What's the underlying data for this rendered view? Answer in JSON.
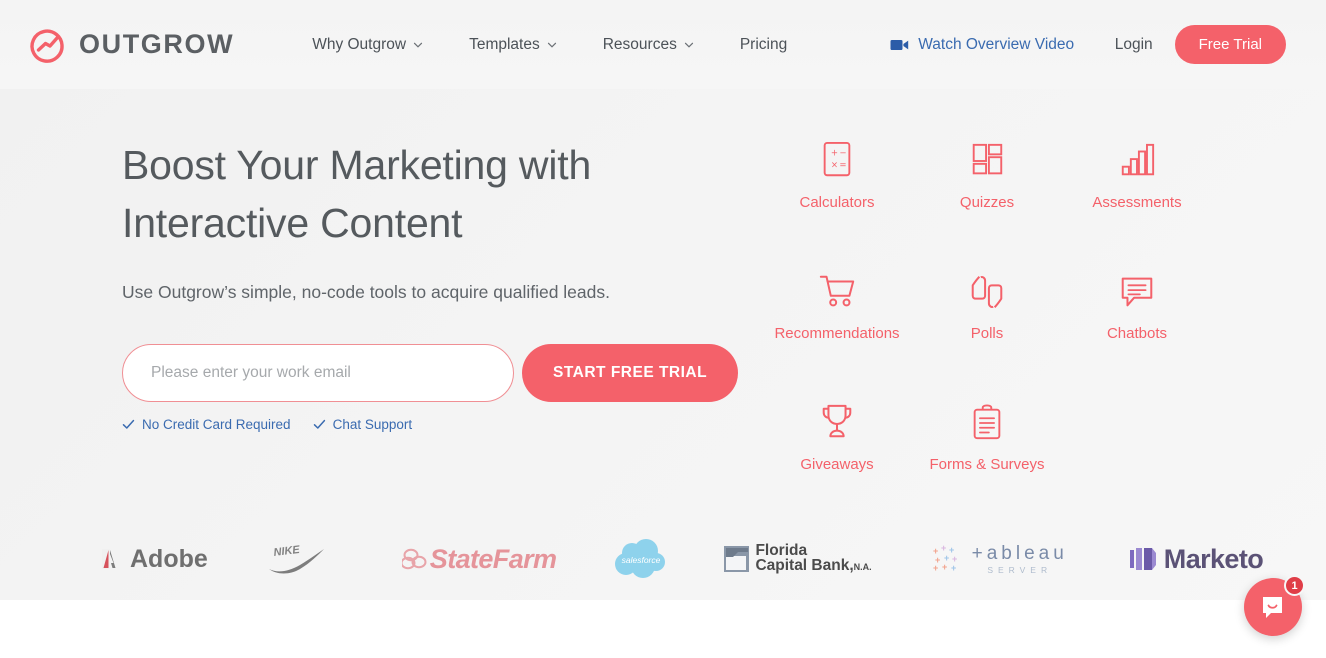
{
  "brand": {
    "name": "OUTGROW",
    "logo_icon": "outgrow-circle-logo",
    "accent_color": "#f4616a",
    "link_blue": "#3a6bb0",
    "text_gray": "#5b5f63"
  },
  "header": {
    "nav": [
      {
        "label": "Why Outgrow",
        "has_chevron": true,
        "icon": "chevron-down-icon"
      },
      {
        "label": "Templates",
        "has_chevron": true,
        "icon": "chevron-down-icon"
      },
      {
        "label": "Resources",
        "has_chevron": true,
        "icon": "chevron-down-icon"
      },
      {
        "label": "Pricing",
        "has_chevron": false,
        "icon": ""
      }
    ],
    "video_link": {
      "label": "Watch Overview Video",
      "icon": "video-camera-icon"
    },
    "login_label": "Login",
    "free_trial_label": "Free Trial"
  },
  "hero": {
    "headline_line1": "Boost Your Marketing with",
    "headline_line2": "Interactive Content",
    "subheading": "Use Outgrow’s simple, no-code tools to acquire qualified leads.",
    "email_placeholder": "Please enter your work email",
    "email_value": "",
    "cta_label": "START FREE TRIAL",
    "assurances": [
      {
        "label": "No Credit Card Required",
        "icon": "check-icon"
      },
      {
        "label": "Chat Support",
        "icon": "check-icon"
      }
    ]
  },
  "features": [
    [
      {
        "label": "Calculators",
        "icon": "calculator-icon"
      },
      {
        "label": "Quizzes",
        "icon": "grid-blocks-icon"
      },
      {
        "label": "Assessments",
        "icon": "bar-chart-icon"
      }
    ],
    [
      {
        "label": "Recommendations",
        "icon": "shopping-cart-icon"
      },
      {
        "label": "Polls",
        "icon": "thumbs-up-down-icon"
      },
      {
        "label": "Chatbots",
        "icon": "chat-bubble-icon"
      }
    ],
    [
      {
        "label": "Giveaways",
        "icon": "trophy-icon"
      },
      {
        "label": "Forms & Surveys",
        "icon": "clipboard-icon"
      }
    ]
  ],
  "brands": [
    {
      "name": "Adobe",
      "icon": "adobe-logo"
    },
    {
      "name": "NIKE",
      "icon": "nike-swoosh-logo"
    },
    {
      "name": "StateFarm",
      "icon": "statefarm-logo"
    },
    {
      "name": "salesforce",
      "icon": "salesforce-cloud-logo"
    },
    {
      "name": "Florida Capital Bank, N.A.",
      "icon": "florida-capital-bank-logo"
    },
    {
      "name": "tableau SERVER",
      "icon": "tableau-server-logo"
    },
    {
      "name": "Marketo",
      "icon": "marketo-logo"
    }
  ],
  "chat": {
    "icon": "intercom-chat-icon",
    "badge_count": "1"
  }
}
